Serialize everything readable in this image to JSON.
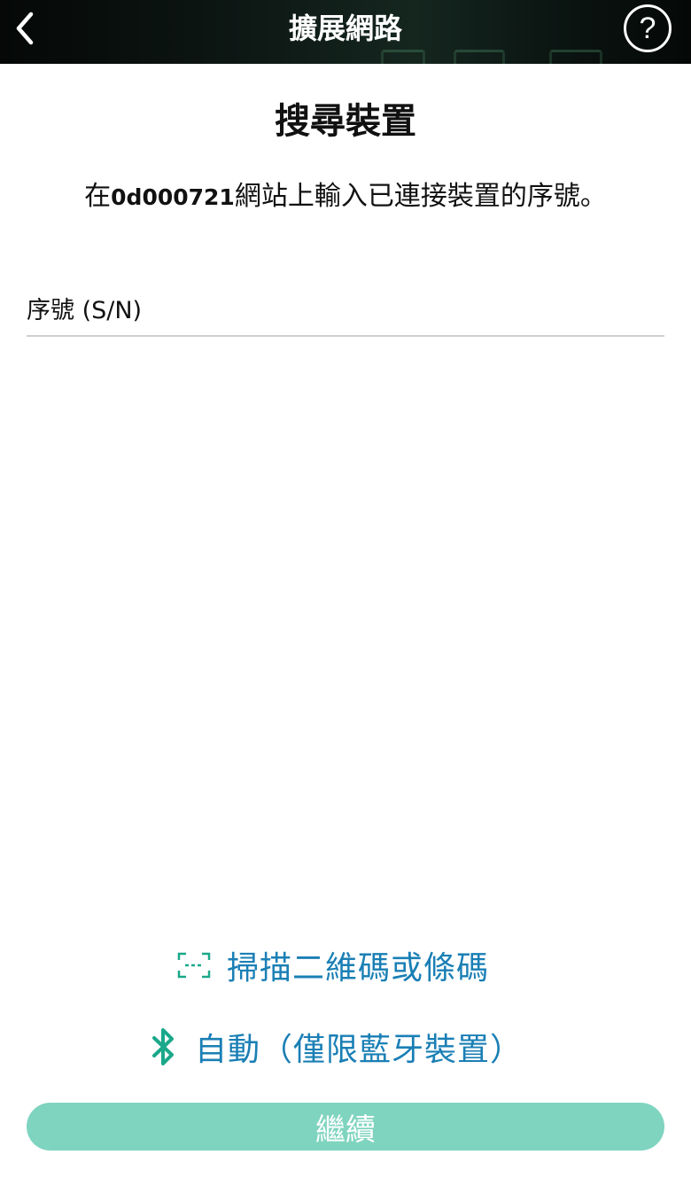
{
  "header": {
    "title": "擴展網路",
    "back_icon": "chevron-left-icon",
    "help_label": "?"
  },
  "page": {
    "title": "搜尋裝置",
    "instruction_prefix": "在",
    "network_name": "0d000721",
    "instruction_suffix": "網站上輸入已連接裝置的序號。"
  },
  "serial": {
    "label": "序號 (S/N)",
    "value": ""
  },
  "actions": {
    "scan_label": "掃描二維碼或條碼",
    "scan_icon": "scan-frame-icon",
    "auto_label": "自動（僅限藍牙裝置）",
    "auto_icon": "bluetooth-icon",
    "continue_label": "繼續"
  },
  "colors": {
    "header_bg": "#0d1714",
    "link_blue": "#1a7fb5",
    "accent_green": "#1aa88a",
    "continue_bg": "#7fd4bf"
  }
}
